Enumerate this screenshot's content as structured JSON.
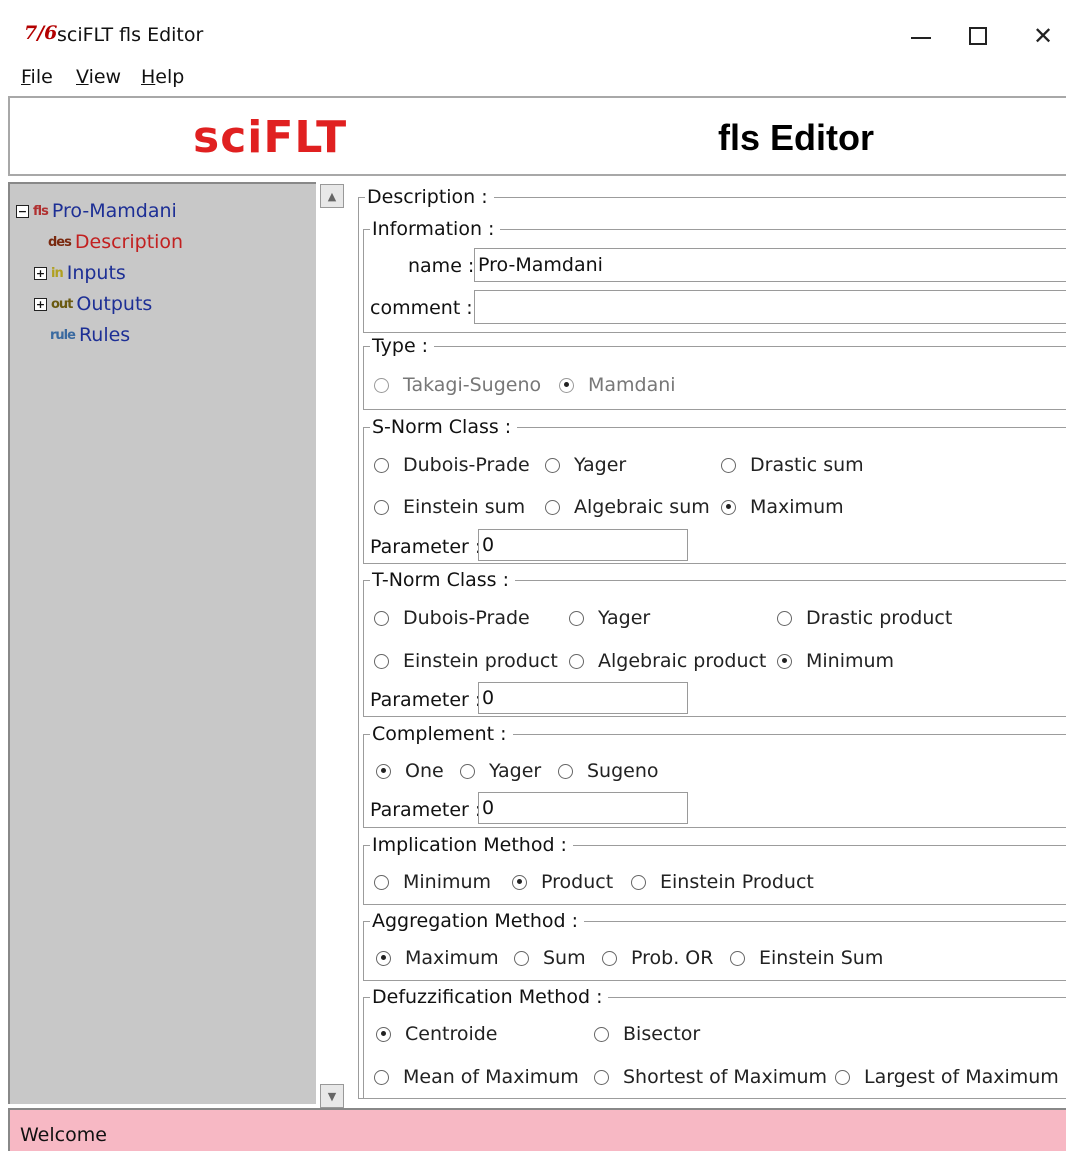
{
  "window": {
    "app_icon": "7/6",
    "title": "sciFLT fls Editor",
    "min_icon": "minimize-icon",
    "max_icon": "maximize-icon",
    "close_symbol": "✕"
  },
  "menu": {
    "file": {
      "first": "F",
      "rest": "ile"
    },
    "view": {
      "first": "V",
      "rest": "iew"
    },
    "help": {
      "first": "H",
      "rest": "elp"
    }
  },
  "banner": {
    "logo": "sciFLT",
    "title": "fls Editor"
  },
  "tree": {
    "root": {
      "icon": "fls",
      "label": "Pro-Mamdani",
      "expander": "−"
    },
    "items": [
      {
        "icon": "des",
        "label": "Description",
        "expander": ""
      },
      {
        "icon": "in",
        "label": "Inputs",
        "expander": "+"
      },
      {
        "icon": "out",
        "label": "Outputs",
        "expander": "+"
      },
      {
        "icon": "rule",
        "label": "Rules",
        "expander": ""
      }
    ]
  },
  "scroll": {
    "up": "▲",
    "down": "▼"
  },
  "form": {
    "description_legend": "Description :",
    "information": {
      "legend": "Information :",
      "name_label": "name :",
      "name_value": "Pro-Mamdani",
      "comment_label": "comment :",
      "comment_value": ""
    },
    "type": {
      "legend": "Type :",
      "options": [
        {
          "label": "Takagi-Sugeno",
          "checked": false
        },
        {
          "label": "Mamdani",
          "checked": true
        }
      ]
    },
    "snorm": {
      "legend": "S-Norm Class :",
      "options": [
        {
          "label": "Dubois-Prade",
          "checked": false
        },
        {
          "label": "Yager",
          "checked": false
        },
        {
          "label": "Drastic sum",
          "checked": false
        },
        {
          "label": "Einstein sum",
          "checked": false
        },
        {
          "label": "Algebraic sum",
          "checked": false
        },
        {
          "label": "Maximum",
          "checked": true
        }
      ],
      "parameter_label": "Parameter :",
      "parameter_value": "0"
    },
    "tnorm": {
      "legend": "T-Norm Class :",
      "options": [
        {
          "label": "Dubois-Prade",
          "checked": false
        },
        {
          "label": "Yager",
          "checked": false
        },
        {
          "label": "Drastic product",
          "checked": false
        },
        {
          "label": "Einstein product",
          "checked": false
        },
        {
          "label": "Algebraic product",
          "checked": false
        },
        {
          "label": "Minimum",
          "checked": true
        }
      ],
      "parameter_label": "Parameter :",
      "parameter_value": "0"
    },
    "complement": {
      "legend": "Complement :",
      "options": [
        {
          "label": "One",
          "checked": true
        },
        {
          "label": "Yager",
          "checked": false
        },
        {
          "label": "Sugeno",
          "checked": false
        }
      ],
      "parameter_label": "Parameter :",
      "parameter_value": "0"
    },
    "implication": {
      "legend": "Implication Method :",
      "options": [
        {
          "label": "Minimum",
          "checked": false
        },
        {
          "label": "Product",
          "checked": true
        },
        {
          "label": "Einstein Product",
          "checked": false
        }
      ]
    },
    "aggregation": {
      "legend": "Aggregation Method :",
      "options": [
        {
          "label": "Maximum",
          "checked": true
        },
        {
          "label": "Sum",
          "checked": false
        },
        {
          "label": "Prob. OR",
          "checked": false
        },
        {
          "label": "Einstein Sum",
          "checked": false
        }
      ]
    },
    "defuzz": {
      "legend": "Defuzzification Method :",
      "options": [
        {
          "label": "Centroide",
          "checked": true
        },
        {
          "label": "Bisector",
          "checked": false
        },
        {
          "label": "Mean of Maximum",
          "checked": false
        },
        {
          "label": "Shortest of Maximum",
          "checked": false
        },
        {
          "label": "Largest of Maximum",
          "checked": false
        }
      ]
    }
  },
  "status": {
    "text": "Welcome"
  },
  "colors": {
    "logo": "#e02020",
    "tree_label": "#1d2f95",
    "tree_active": "#c22020",
    "tree_background": "#c8c8c8",
    "status_background": "#f7b8c4"
  }
}
